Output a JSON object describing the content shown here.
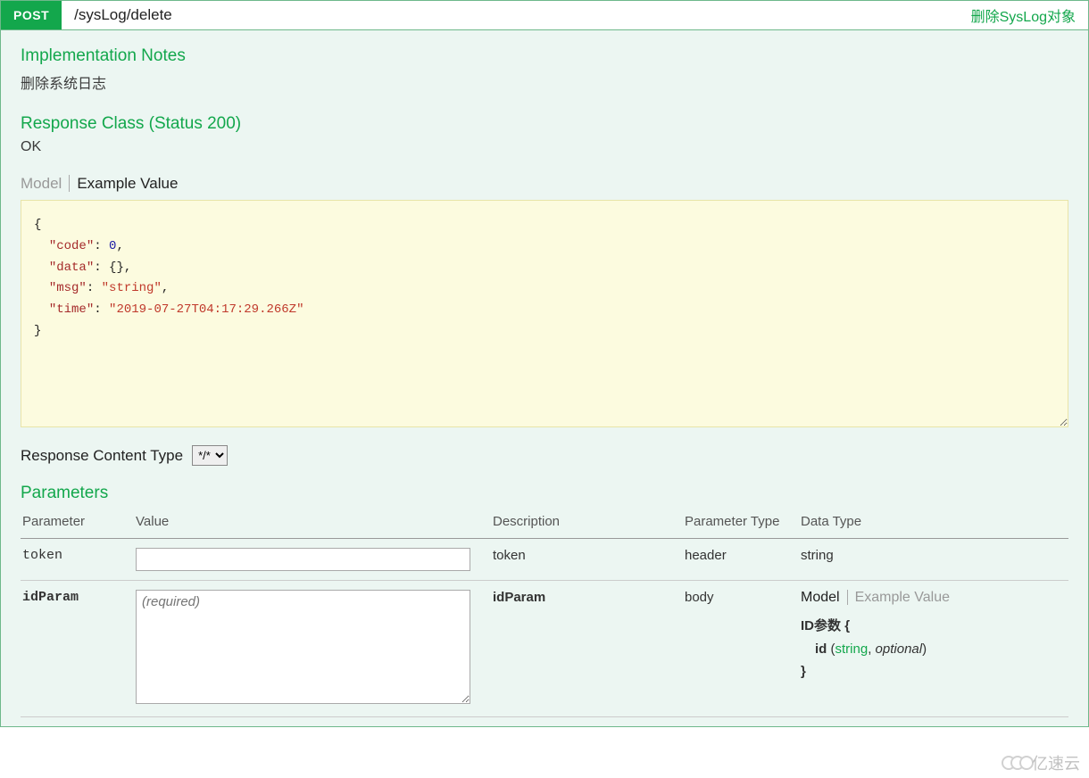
{
  "header": {
    "method": "POST",
    "path": "/sysLog/delete",
    "summary": "删除SysLog对象"
  },
  "sections": {
    "impl_notes_title": "Implementation Notes",
    "impl_notes_text": "删除系统日志",
    "response_class_title": "Response Class (Status 200)",
    "response_class_status": "OK",
    "tabs": {
      "model": "Model",
      "example": "Example Value"
    },
    "response_content_type_label": "Response Content Type",
    "content_type_value": "*/*",
    "parameters_title": "Parameters"
  },
  "example_json": {
    "line_open": "{",
    "k_code": "\"code\"",
    "v_code": "0",
    "k_data": "\"data\"",
    "v_data": "{}",
    "k_msg": "\"msg\"",
    "v_msg": "\"string\"",
    "k_time": "\"time\"",
    "v_time": "\"2019-07-27T04:17:29.266Z\"",
    "line_close": "}"
  },
  "params_table": {
    "headers": {
      "parameter": "Parameter",
      "value": "Value",
      "description": "Description",
      "param_type": "Parameter Type",
      "data_type": "Data Type"
    },
    "rows": {
      "token": {
        "param": "token",
        "value": "",
        "description": "token",
        "param_type": "header",
        "data_type": "string"
      },
      "idParam": {
        "param": "idParam",
        "placeholder": "(required)",
        "description": "idParam",
        "param_type": "body",
        "dt_tabs": {
          "model": "Model",
          "example": "Example Value"
        },
        "model": {
          "title": "ID参数",
          "open": "{",
          "field": "id",
          "type": "string",
          "optional": "optional",
          "close": "}"
        }
      }
    }
  },
  "watermark": "亿速云"
}
